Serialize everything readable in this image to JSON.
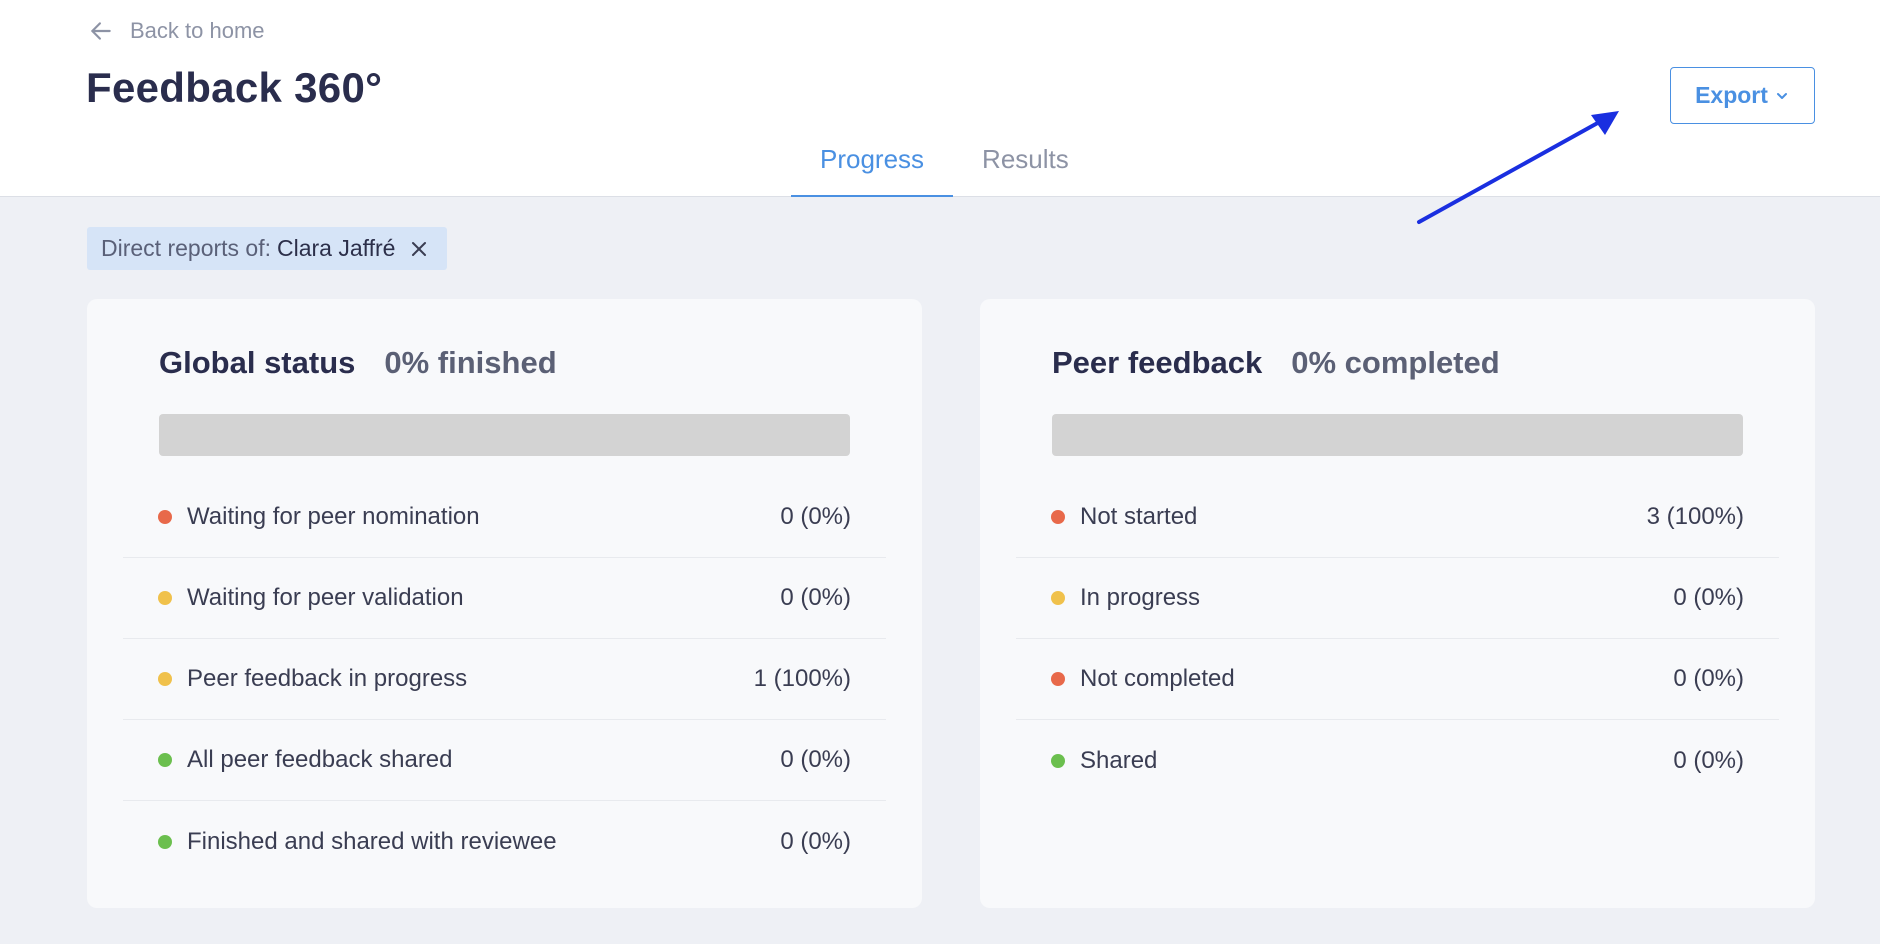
{
  "header": {
    "back_label": "Back to home",
    "title": "Feedback 360°",
    "export_label": "Export"
  },
  "tabs": [
    {
      "label": "Progress",
      "active": true
    },
    {
      "label": "Results",
      "active": false
    }
  ],
  "filter": {
    "prefix": "Direct reports of:",
    "value": "Clara Jaffré"
  },
  "global_status": {
    "title": "Global status",
    "summary": "0% finished",
    "progress": 0,
    "rows": [
      {
        "label": "Waiting for peer nomination",
        "value": "0 (0%)",
        "color": "#e8694a"
      },
      {
        "label": "Waiting for peer validation",
        "value": "0 (0%)",
        "color": "#f0c14b"
      },
      {
        "label": "Peer feedback in progress",
        "value": "1 (100%)",
        "color": "#f0c14b"
      },
      {
        "label": "All peer feedback shared",
        "value": "0 (0%)",
        "color": "#6bbf4e"
      },
      {
        "label": "Finished and shared with reviewee",
        "value": "0 (0%)",
        "color": "#6bbf4e"
      }
    ]
  },
  "peer_feedback": {
    "title": "Peer feedback",
    "summary": "0% completed",
    "progress": 0,
    "rows": [
      {
        "label": "Not started",
        "value": "3 (100%)",
        "color": "#e8694a"
      },
      {
        "label": "In progress",
        "value": "0 (0%)",
        "color": "#f0c14b"
      },
      {
        "label": "Not completed",
        "value": "0 (0%)",
        "color": "#e8694a"
      },
      {
        "label": "Shared",
        "value": "0 (0%)",
        "color": "#6bbf4e"
      }
    ]
  },
  "colors": {
    "accent": "#4a90e2",
    "annotation_arrow": "#1a2fe0"
  }
}
